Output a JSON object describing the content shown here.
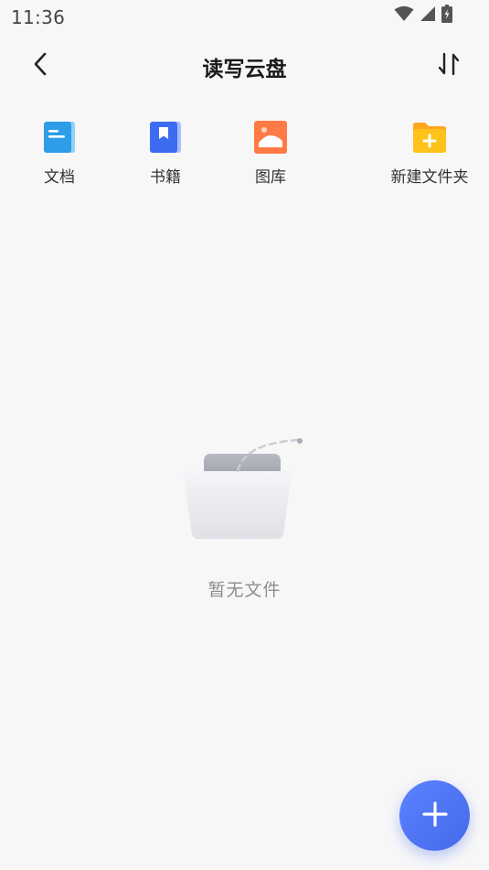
{
  "status_bar": {
    "time": "11:36"
  },
  "header": {
    "title": "读写云盘"
  },
  "quick_actions": [
    {
      "label": "文档",
      "icon": "document-icon",
      "color": "#2e9ce8"
    },
    {
      "label": "书籍",
      "icon": "book-icon",
      "color": "#3d6cf2"
    },
    {
      "label": "图库",
      "icon": "gallery-icon",
      "color": "#ff7a45"
    },
    {
      "label": "新建文件夹",
      "icon": "new-folder-icon",
      "color": "#ffc21a"
    }
  ],
  "empty_state": {
    "message": "暂无文件"
  },
  "colors": {
    "background": "#f7f7f8",
    "fab": "#4f75f5"
  }
}
